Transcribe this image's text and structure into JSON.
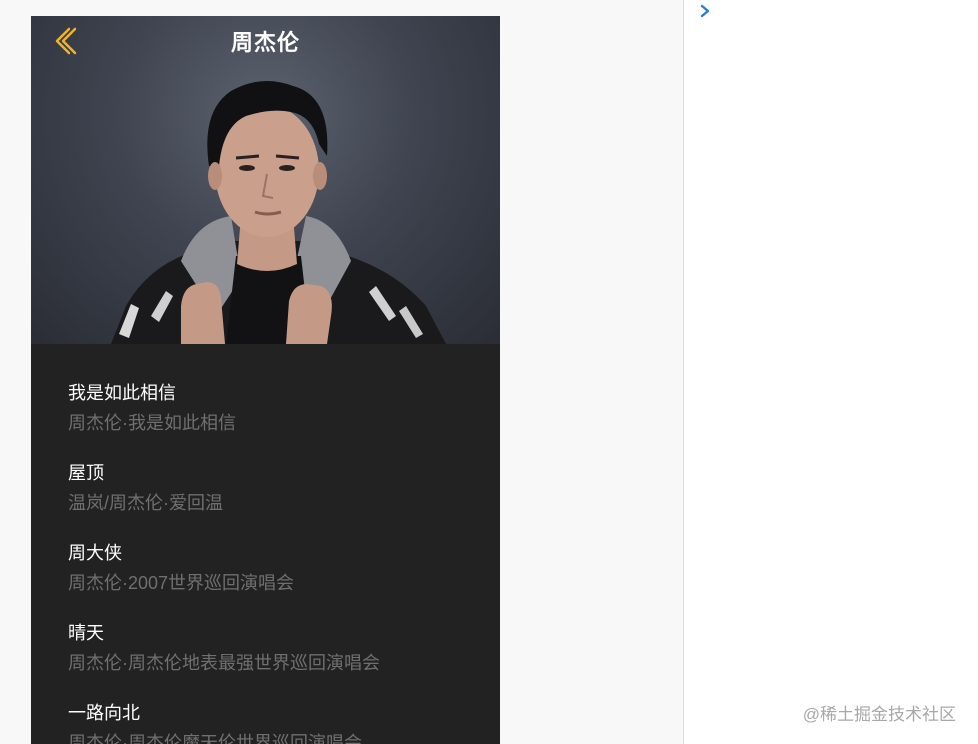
{
  "header": {
    "title": "周杰伦"
  },
  "icons": {
    "back": "back-chevron-icon",
    "expand": "expand-arrow-icon",
    "back_color": "#f0b429",
    "expand_color": "#2b7cd3"
  },
  "songs": [
    {
      "title": "我是如此相信",
      "subtitle": "周杰伦·我是如此相信"
    },
    {
      "title": "屋顶",
      "subtitle": "温岚/周杰伦·爱回温"
    },
    {
      "title": "周大侠",
      "subtitle": "周杰伦·2007世界巡回演唱会"
    },
    {
      "title": "晴天",
      "subtitle": "周杰伦·周杰伦地表最强世界巡回演唱会"
    },
    {
      "title": "一路向北",
      "subtitle": "周杰伦·周杰伦魔天伦世界巡回演唱会"
    }
  ],
  "watermark": "@稀土掘金技术社区",
  "colors": {
    "list_bg": "#222222",
    "title_text": "#ffffff",
    "subtitle_text": "#6f6f6f"
  }
}
